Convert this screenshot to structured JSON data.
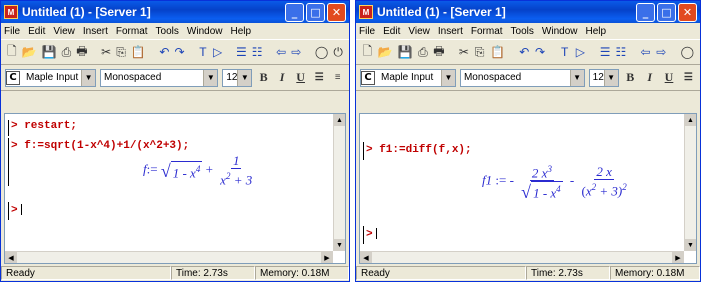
{
  "windows": [
    {
      "title": "Untitled (1) - [Server 1]",
      "app_icon": "M",
      "menu": [
        "File",
        "Edit",
        "View",
        "Insert",
        "Format",
        "Tools",
        "Window",
        "Help"
      ],
      "format": {
        "style": "Maple Input",
        "style_icon": "C",
        "font": "Monospaced",
        "size": "12"
      },
      "commands": [
        "restart;",
        "f:=sqrt(1-x^4)+1/(x^2+3);"
      ],
      "output": {
        "lhs": "f",
        "rad_body": "1 - x",
        "rad_exp": "4",
        "plus": "+",
        "num": "1",
        "den_base": "x",
        "den_exp": "2",
        "den_rest": "+ 3"
      },
      "status": {
        "ready": "Ready",
        "time": "Time: 2.73s",
        "memory": "Memory: 0.18M"
      }
    },
    {
      "title": "Untitled (1) - [Server 1]",
      "app_icon": "M",
      "menu": [
        "File",
        "Edit",
        "View",
        "Insert",
        "Format",
        "Tools",
        "Window",
        "Help"
      ],
      "format": {
        "style": "Maple Input",
        "style_icon": "C",
        "font": "Monospaced",
        "size": "12"
      },
      "commands": [
        "f1:=diff(f,x);"
      ],
      "output": {
        "lhs": "f1",
        "minus": "-",
        "num1": "2 x",
        "num1_exp": "3",
        "den1_body": "1 - x",
        "den1_exp": "4",
        "num2": "2 x",
        "den2_base": "x",
        "den2_exp": "2",
        "den2_rest": "+ 3)",
        "den2_outer_exp": "2"
      },
      "status": {
        "ready": "Ready",
        "time": "Time: 2.73s",
        "memory": "Memory: 0.18M"
      }
    }
  ],
  "icons": {
    "minimize": "minimize-icon",
    "maximize": "maximize-icon",
    "close": "close-icon",
    "toolbar": [
      "new-icon",
      "open-icon",
      "save-icon",
      "print-icon",
      "print-preview-icon",
      "cut-icon",
      "copy-icon",
      "paste-icon",
      "undo-icon",
      "redo-icon",
      "text-icon",
      "execute-icon",
      "indent-icon",
      "outdent-icon",
      "back-icon",
      "forward-icon",
      "stop-icon",
      "restart-icon"
    ]
  },
  "colors": {
    "titlebar": "#0a5ae8",
    "input": "#c00000",
    "output": "#2b2bd0",
    "chrome": "#ece9d8"
  }
}
